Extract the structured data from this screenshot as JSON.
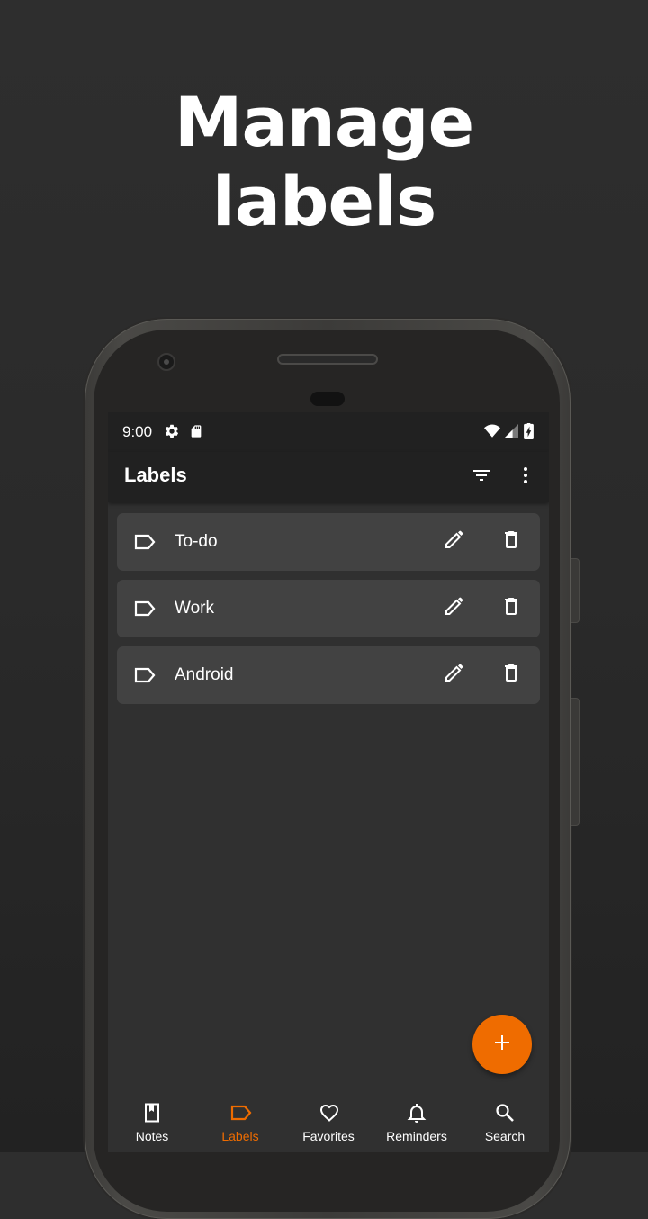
{
  "headline": {
    "line1": "Manage",
    "line2": "labels"
  },
  "status_bar": {
    "time": "9:00",
    "icons": [
      "settings-icon",
      "sd-card-icon",
      "wifi-icon",
      "cell-signal-icon",
      "battery-charging-icon"
    ]
  },
  "app_bar": {
    "title": "Labels",
    "actions": [
      "filter-icon",
      "more-vert-icon"
    ]
  },
  "labels": [
    {
      "name": "To-do"
    },
    {
      "name": "Work"
    },
    {
      "name": "Android"
    }
  ],
  "fab": {
    "icon": "plus-icon"
  },
  "bottom_nav": {
    "items": [
      {
        "label": "Notes",
        "icon": "bookmark-book-icon"
      },
      {
        "label": "Labels",
        "icon": "label-tag-icon",
        "active": true
      },
      {
        "label": "Favorites",
        "icon": "heart-icon"
      },
      {
        "label": "Reminders",
        "icon": "bell-icon"
      },
      {
        "label": "Search",
        "icon": "search-icon"
      }
    ]
  },
  "colors": {
    "accent": "#ef6c00",
    "app_bar": "#212121",
    "background": "#303030",
    "card": "#424242"
  }
}
